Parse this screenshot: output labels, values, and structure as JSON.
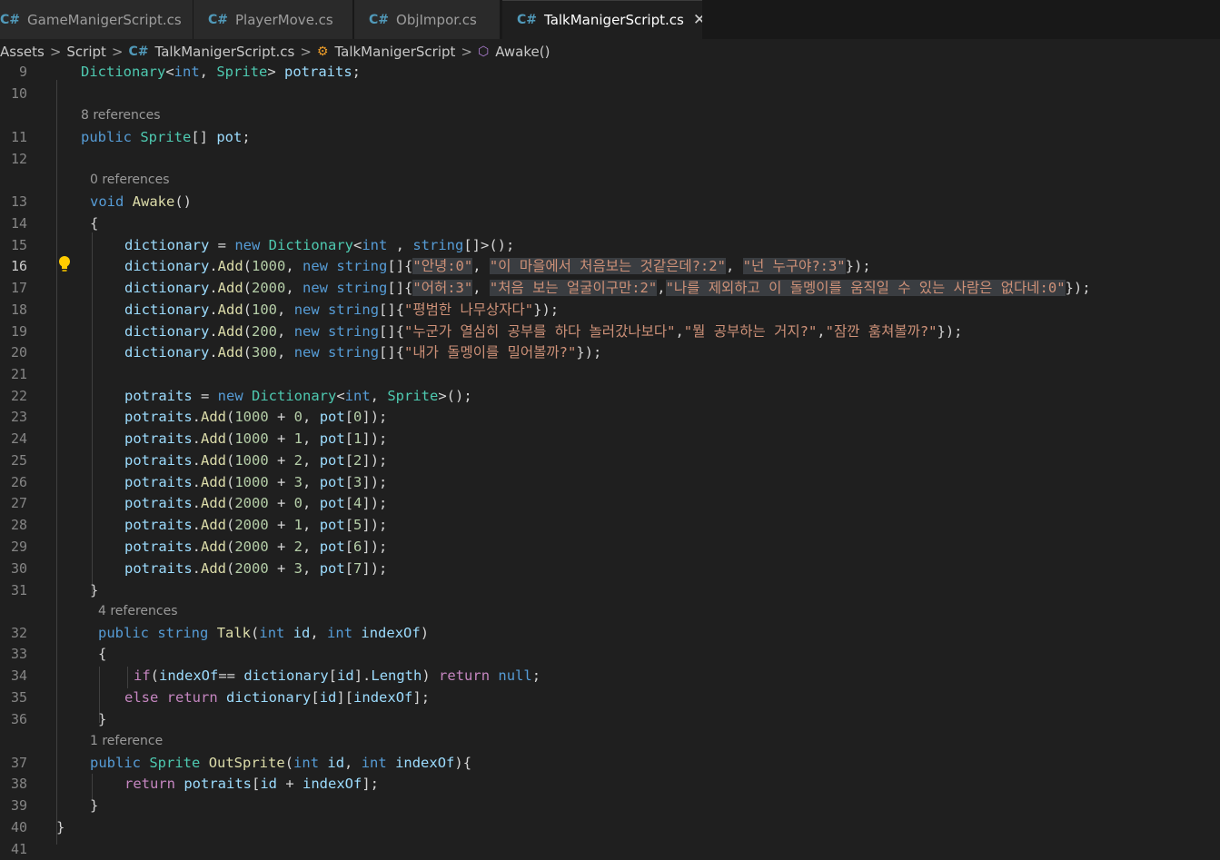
{
  "tabs": [
    {
      "label": "GameManigerScript.cs",
      "active": false
    },
    {
      "label": "PlayerMove.cs",
      "active": false
    },
    {
      "label": "ObjImpor.cs",
      "active": false
    },
    {
      "label": "TalkManigerScript.cs",
      "active": true
    }
  ],
  "tab_close_glyph": "✕",
  "breadcrumb": {
    "items": [
      "Assets",
      "Script",
      "TalkManigerScript.cs",
      "TalkManigerScript",
      "Awake()"
    ],
    "separator": ">"
  },
  "code_lens": {
    "l11": "8 references",
    "l13": "0 references",
    "l32": "4 references",
    "l37": "1 reference"
  },
  "cursor_line": 16,
  "colors": {
    "background": "#1f1f1f",
    "keyword": "#569cd6",
    "type": "#4ec9b0",
    "function": "#dcdcaa",
    "string": "#ce9178",
    "variable": "#9cdcfe",
    "number": "#b5cea8",
    "control": "#c586c0",
    "line_number": "#858585"
  },
  "lines": [
    {
      "no": "9",
      "tokens": [
        [
          "t",
          "Dictionary"
        ],
        [
          "p",
          "<"
        ],
        [
          "k",
          "int"
        ],
        [
          "p",
          ", "
        ],
        [
          "t",
          "Sprite"
        ],
        [
          "p",
          "> "
        ],
        [
          "v",
          "potraits"
        ],
        [
          "p",
          ";"
        ]
      ]
    },
    {
      "no": "10",
      "tokens": []
    },
    {
      "no": "11",
      "tokens": [
        [
          "k",
          "public"
        ],
        [
          "p",
          " "
        ],
        [
          "t",
          "Sprite"
        ],
        [
          "p",
          "[] "
        ],
        [
          "v",
          "pot"
        ],
        [
          "p",
          ";"
        ]
      ]
    },
    {
      "no": "12",
      "tokens": []
    },
    {
      "no": "13",
      "tokens": [
        [
          "k",
          "void"
        ],
        [
          "p",
          " "
        ],
        [
          "f",
          "Awake"
        ],
        [
          "p",
          "()"
        ]
      ]
    },
    {
      "no": "14",
      "tokens": [
        [
          "p",
          "{"
        ]
      ]
    },
    {
      "no": "15",
      "tokens": [
        [
          "v",
          "dictionary"
        ],
        [
          "p",
          " = "
        ],
        [
          "k",
          "new"
        ],
        [
          "p",
          " "
        ],
        [
          "t",
          "Dictionary"
        ],
        [
          "p",
          "<"
        ],
        [
          "k",
          "int"
        ],
        [
          "p",
          " , "
        ],
        [
          "k",
          "string"
        ],
        [
          "p",
          "[]>();"
        ]
      ]
    },
    {
      "no": "16",
      "tokens": [
        [
          "v",
          "dictionary"
        ],
        [
          "p",
          "."
        ],
        [
          "f",
          "Add"
        ],
        [
          "p",
          "("
        ],
        [
          "n",
          "1000"
        ],
        [
          "p",
          ", "
        ],
        [
          "k",
          "new"
        ],
        [
          "p",
          " "
        ],
        [
          "k",
          "string"
        ],
        [
          "p",
          "[]{"
        ],
        [
          "s",
          "\"안녕:0\""
        ],
        [
          "p",
          ", "
        ],
        [
          "s",
          "\"이 마을에서 처음보는 것같은데?:2\""
        ],
        [
          "p",
          ", "
        ],
        [
          "s",
          "\"넌 누구야?:3\""
        ],
        [
          "p",
          "});"
        ]
      ]
    },
    {
      "no": "17",
      "tokens": [
        [
          "v",
          "dictionary"
        ],
        [
          "p",
          "."
        ],
        [
          "f",
          "Add"
        ],
        [
          "p",
          "("
        ],
        [
          "n",
          "2000"
        ],
        [
          "p",
          ", "
        ],
        [
          "k",
          "new"
        ],
        [
          "p",
          " "
        ],
        [
          "k",
          "string"
        ],
        [
          "p",
          "[]{"
        ],
        [
          "s",
          "\"어허:3\""
        ],
        [
          "p",
          ", "
        ],
        [
          "s",
          "\"처음 보는 얼굴이구만:2\""
        ],
        [
          "p",
          ","
        ],
        [
          "s",
          "\"나를 제외하고 이 돌멩이를 움직일 수 있는 사람은 없다네:0\""
        ],
        [
          "p",
          "});"
        ]
      ]
    },
    {
      "no": "18",
      "tokens": [
        [
          "v",
          "dictionary"
        ],
        [
          "p",
          "."
        ],
        [
          "f",
          "Add"
        ],
        [
          "p",
          "("
        ],
        [
          "n",
          "100"
        ],
        [
          "p",
          ", "
        ],
        [
          "k",
          "new"
        ],
        [
          "p",
          " "
        ],
        [
          "k",
          "string"
        ],
        [
          "p",
          "[]{"
        ],
        [
          "s",
          "\"평범한 나무상자다\""
        ],
        [
          "p",
          "});"
        ]
      ]
    },
    {
      "no": "19",
      "tokens": [
        [
          "v",
          "dictionary"
        ],
        [
          "p",
          "."
        ],
        [
          "f",
          "Add"
        ],
        [
          "p",
          "("
        ],
        [
          "n",
          "200"
        ],
        [
          "p",
          ", "
        ],
        [
          "k",
          "new"
        ],
        [
          "p",
          " "
        ],
        [
          "k",
          "string"
        ],
        [
          "p",
          "[]{"
        ],
        [
          "s",
          "\"누군가 열심히 공부를 하다 놀러갔나보다\""
        ],
        [
          "p",
          ","
        ],
        [
          "s",
          "\"뭘 공부하는 거지?\""
        ],
        [
          "p",
          ","
        ],
        [
          "s",
          "\"잠깐 훔쳐볼까?\""
        ],
        [
          "p",
          "});"
        ]
      ]
    },
    {
      "no": "20",
      "tokens": [
        [
          "v",
          "dictionary"
        ],
        [
          "p",
          "."
        ],
        [
          "f",
          "Add"
        ],
        [
          "p",
          "("
        ],
        [
          "n",
          "300"
        ],
        [
          "p",
          ", "
        ],
        [
          "k",
          "new"
        ],
        [
          "p",
          " "
        ],
        [
          "k",
          "string"
        ],
        [
          "p",
          "[]{"
        ],
        [
          "s",
          "\"내가 돌멩이를 밀어볼까?\""
        ],
        [
          "p",
          "});"
        ]
      ]
    },
    {
      "no": "21",
      "tokens": []
    },
    {
      "no": "22",
      "tokens": [
        [
          "v",
          "potraits"
        ],
        [
          "p",
          " = "
        ],
        [
          "k",
          "new"
        ],
        [
          "p",
          " "
        ],
        [
          "t",
          "Dictionary"
        ],
        [
          "p",
          "<"
        ],
        [
          "k",
          "int"
        ],
        [
          "p",
          ", "
        ],
        [
          "t",
          "Sprite"
        ],
        [
          "p",
          ">();"
        ]
      ]
    },
    {
      "no": "23",
      "tokens": [
        [
          "v",
          "potraits"
        ],
        [
          "p",
          "."
        ],
        [
          "f",
          "Add"
        ],
        [
          "p",
          "("
        ],
        [
          "n",
          "1000"
        ],
        [
          "p",
          " + "
        ],
        [
          "n",
          "0"
        ],
        [
          "p",
          ", "
        ],
        [
          "v",
          "pot"
        ],
        [
          "p",
          "["
        ],
        [
          "n",
          "0"
        ],
        [
          "p",
          "]);"
        ]
      ]
    },
    {
      "no": "24",
      "tokens": [
        [
          "v",
          "potraits"
        ],
        [
          "p",
          "."
        ],
        [
          "f",
          "Add"
        ],
        [
          "p",
          "("
        ],
        [
          "n",
          "1000"
        ],
        [
          "p",
          " + "
        ],
        [
          "n",
          "1"
        ],
        [
          "p",
          ", "
        ],
        [
          "v",
          "pot"
        ],
        [
          "p",
          "["
        ],
        [
          "n",
          "1"
        ],
        [
          "p",
          "]);"
        ]
      ]
    },
    {
      "no": "25",
      "tokens": [
        [
          "v",
          "potraits"
        ],
        [
          "p",
          "."
        ],
        [
          "f",
          "Add"
        ],
        [
          "p",
          "("
        ],
        [
          "n",
          "1000"
        ],
        [
          "p",
          " + "
        ],
        [
          "n",
          "2"
        ],
        [
          "p",
          ", "
        ],
        [
          "v",
          "pot"
        ],
        [
          "p",
          "["
        ],
        [
          "n",
          "2"
        ],
        [
          "p",
          "]);"
        ]
      ]
    },
    {
      "no": "26",
      "tokens": [
        [
          "v",
          "potraits"
        ],
        [
          "p",
          "."
        ],
        [
          "f",
          "Add"
        ],
        [
          "p",
          "("
        ],
        [
          "n",
          "1000"
        ],
        [
          "p",
          " + "
        ],
        [
          "n",
          "3"
        ],
        [
          "p",
          ", "
        ],
        [
          "v",
          "pot"
        ],
        [
          "p",
          "["
        ],
        [
          "n",
          "3"
        ],
        [
          "p",
          "]);"
        ]
      ]
    },
    {
      "no": "27",
      "tokens": [
        [
          "v",
          "potraits"
        ],
        [
          "p",
          "."
        ],
        [
          "f",
          "Add"
        ],
        [
          "p",
          "("
        ],
        [
          "n",
          "2000"
        ],
        [
          "p",
          " + "
        ],
        [
          "n",
          "0"
        ],
        [
          "p",
          ", "
        ],
        [
          "v",
          "pot"
        ],
        [
          "p",
          "["
        ],
        [
          "n",
          "4"
        ],
        [
          "p",
          "]);"
        ]
      ]
    },
    {
      "no": "28",
      "tokens": [
        [
          "v",
          "potraits"
        ],
        [
          "p",
          "."
        ],
        [
          "f",
          "Add"
        ],
        [
          "p",
          "("
        ],
        [
          "n",
          "2000"
        ],
        [
          "p",
          " + "
        ],
        [
          "n",
          "1"
        ],
        [
          "p",
          ", "
        ],
        [
          "v",
          "pot"
        ],
        [
          "p",
          "["
        ],
        [
          "n",
          "5"
        ],
        [
          "p",
          "]);"
        ]
      ]
    },
    {
      "no": "29",
      "tokens": [
        [
          "v",
          "potraits"
        ],
        [
          "p",
          "."
        ],
        [
          "f",
          "Add"
        ],
        [
          "p",
          "("
        ],
        [
          "n",
          "2000"
        ],
        [
          "p",
          " + "
        ],
        [
          "n",
          "2"
        ],
        [
          "p",
          ", "
        ],
        [
          "v",
          "pot"
        ],
        [
          "p",
          "["
        ],
        [
          "n",
          "6"
        ],
        [
          "p",
          "]);"
        ]
      ]
    },
    {
      "no": "30",
      "tokens": [
        [
          "v",
          "potraits"
        ],
        [
          "p",
          "."
        ],
        [
          "f",
          "Add"
        ],
        [
          "p",
          "("
        ],
        [
          "n",
          "2000"
        ],
        [
          "p",
          " + "
        ],
        [
          "n",
          "3"
        ],
        [
          "p",
          ", "
        ],
        [
          "v",
          "pot"
        ],
        [
          "p",
          "["
        ],
        [
          "n",
          "7"
        ],
        [
          "p",
          "]);"
        ]
      ]
    },
    {
      "no": "31",
      "tokens": [
        [
          "p",
          "}"
        ]
      ]
    },
    {
      "no": "32",
      "tokens": [
        [
          "k",
          "public"
        ],
        [
          "p",
          " "
        ],
        [
          "k",
          "string"
        ],
        [
          "p",
          " "
        ],
        [
          "f",
          "Talk"
        ],
        [
          "p",
          "("
        ],
        [
          "k",
          "int"
        ],
        [
          "p",
          " "
        ],
        [
          "v",
          "id"
        ],
        [
          "p",
          ", "
        ],
        [
          "k",
          "int"
        ],
        [
          "p",
          " "
        ],
        [
          "v",
          "indexOf"
        ],
        [
          "p",
          ")"
        ]
      ]
    },
    {
      "no": "33",
      "tokens": [
        [
          "p",
          "{"
        ]
      ]
    },
    {
      "no": "34",
      "tokens": [
        [
          "c",
          "if"
        ],
        [
          "p",
          "("
        ],
        [
          "v",
          "indexOf"
        ],
        [
          "p",
          "== "
        ],
        [
          "v",
          "dictionary"
        ],
        [
          "p",
          "["
        ],
        [
          "v",
          "id"
        ],
        [
          "p",
          "]."
        ],
        [
          "v",
          "Length"
        ],
        [
          "p",
          ") "
        ],
        [
          "c",
          "return"
        ],
        [
          "p",
          " "
        ],
        [
          "k",
          "null"
        ],
        [
          "p",
          ";"
        ]
      ]
    },
    {
      "no": "35",
      "tokens": [
        [
          "c",
          "else"
        ],
        [
          "p",
          " "
        ],
        [
          "c",
          "return"
        ],
        [
          "p",
          " "
        ],
        [
          "v",
          "dictionary"
        ],
        [
          "p",
          "["
        ],
        [
          "v",
          "id"
        ],
        [
          "p",
          "]["
        ],
        [
          "v",
          "indexOf"
        ],
        [
          "p",
          "];"
        ]
      ]
    },
    {
      "no": "36",
      "tokens": [
        [
          "p",
          "}"
        ]
      ]
    },
    {
      "no": "37",
      "tokens": [
        [
          "k",
          "public"
        ],
        [
          "p",
          " "
        ],
        [
          "t",
          "Sprite"
        ],
        [
          "p",
          " "
        ],
        [
          "f",
          "OutSprite"
        ],
        [
          "p",
          "("
        ],
        [
          "k",
          "int"
        ],
        [
          "p",
          " "
        ],
        [
          "v",
          "id"
        ],
        [
          "p",
          ", "
        ],
        [
          "k",
          "int"
        ],
        [
          "p",
          " "
        ],
        [
          "v",
          "indexOf"
        ],
        [
          "p",
          "){"
        ]
      ]
    },
    {
      "no": "38",
      "tokens": [
        [
          "c",
          "return"
        ],
        [
          "p",
          " "
        ],
        [
          "v",
          "potraits"
        ],
        [
          "p",
          "["
        ],
        [
          "v",
          "id"
        ],
        [
          "p",
          " + "
        ],
        [
          "v",
          "indexOf"
        ],
        [
          "p",
          "];"
        ]
      ]
    },
    {
      "no": "39",
      "tokens": [
        [
          "p",
          "}"
        ]
      ]
    },
    {
      "no": "40",
      "tokens": [
        [
          "p",
          "}"
        ]
      ]
    },
    {
      "no": "41",
      "tokens": []
    }
  ]
}
